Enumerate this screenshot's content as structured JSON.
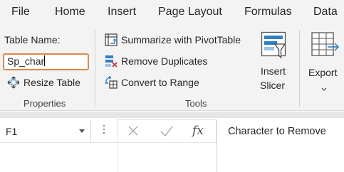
{
  "menu": {
    "tabs": [
      "File",
      "Home",
      "Insert",
      "Page Layout",
      "Formulas",
      "Data"
    ]
  },
  "ribbon": {
    "properties": {
      "table_name_label": "Table Name:",
      "table_name_value": "Sp_char",
      "resize_label": "Resize Table",
      "group_label": "Properties"
    },
    "tools": {
      "summarize_label": "Summarize with PivotTable",
      "remove_duplicates_label": "Remove Duplicates",
      "convert_label": "Convert to Range",
      "insert_slicer_line1": "Insert",
      "insert_slicer_line2": "Slicer",
      "group_label": "Tools"
    },
    "external": {
      "export_label": "Export"
    }
  },
  "formula_bar": {
    "name_box_value": "F1",
    "cancel_glyph": "✕",
    "enter_glyph": "✓",
    "fx_glyph": "fx",
    "content": "Character to Remove"
  },
  "icons": {
    "pivot": "pivot-table-icon",
    "remove_duplicates": "remove-duplicates-icon",
    "convert": "convert-to-range-icon",
    "resize": "resize-table-icon",
    "slicer": "insert-slicer-icon",
    "export": "export-icon"
  },
  "colors": {
    "accent_blue": "#2f7fc1",
    "remove_red": "#d13438",
    "input_border": "#d98a4e"
  }
}
